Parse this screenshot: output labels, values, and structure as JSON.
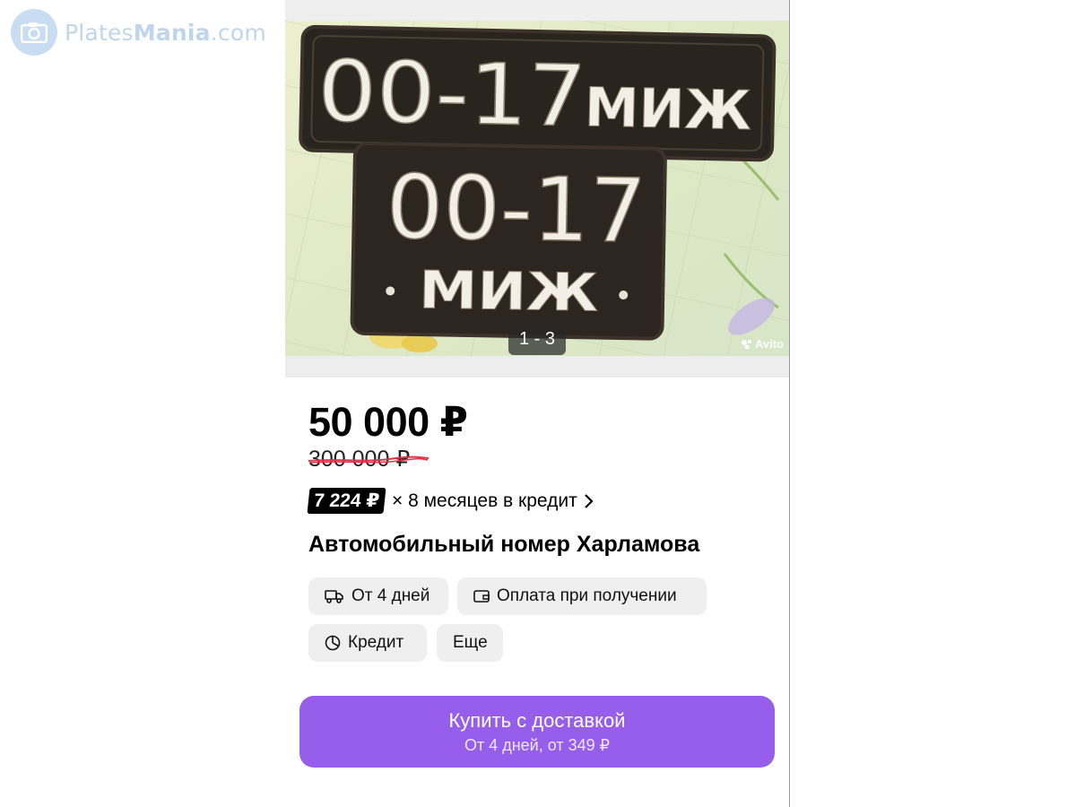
{
  "watermark": {
    "brand_first": "Plates",
    "brand_second": "Mania",
    "brand_suffix": ".com"
  },
  "listing": {
    "photo": {
      "counter": "1 - 3",
      "brand_mark": "Avito",
      "plate_long": {
        "digits": "00-17",
        "letters": "МИЖ"
      },
      "plate_square": {
        "digits": "00-17",
        "letters": "МИЖ"
      }
    },
    "price": "50 000 ₽",
    "old_price": "300 000 ₽",
    "credit": {
      "monthly": "7 224 ₽",
      "text": "× 8 месяцев в кредит"
    },
    "title": "Автомобильный номер Харламова",
    "chips": [
      {
        "label": "От 4 дней",
        "icon": "truck-icon"
      },
      {
        "label": "Оплата при получении",
        "icon": "wallet-icon"
      },
      {
        "label": "Кредит",
        "icon": "pie-chart-icon"
      },
      {
        "label": "Еще",
        "icon": ""
      }
    ],
    "buy_button": {
      "label": "Купить с доставкой",
      "sub": "От 4 дней, от 349 ₽"
    }
  },
  "colors": {
    "accent": "#965eeb",
    "strike": "#e0334a",
    "chip_bg": "#efefef"
  }
}
